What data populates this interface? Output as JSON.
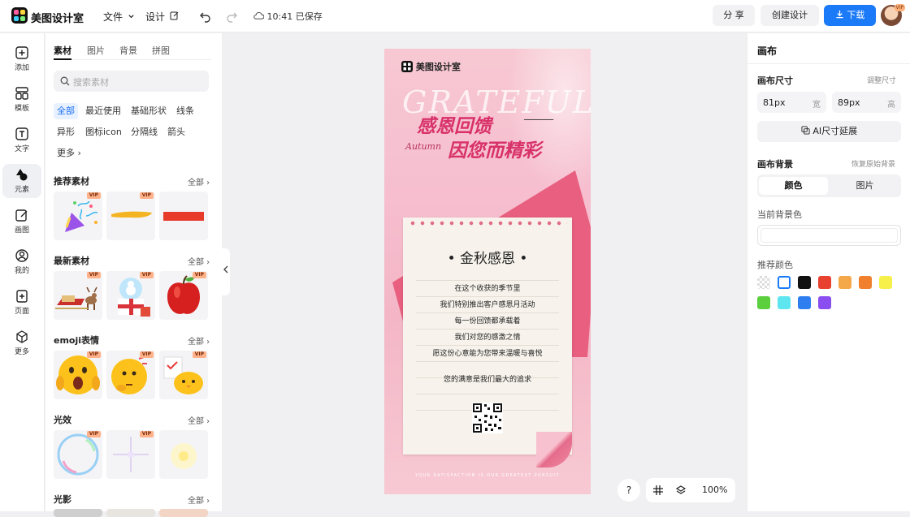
{
  "app": {
    "name": "美图设计室"
  },
  "topbar": {
    "file_menu": "文件",
    "design_menu": "设计",
    "save_status": "10:41 已保存",
    "share_label": "分 享",
    "create_label": "创建设计",
    "download_label": "下载",
    "avatar_badge": "VIP"
  },
  "rail": {
    "items": [
      {
        "label": "添加",
        "icon": "plus-square-icon"
      },
      {
        "label": "模板",
        "icon": "template-grid-icon"
      },
      {
        "label": "文字",
        "icon": "text-icon"
      },
      {
        "label": "元素",
        "icon": "shapes-icon"
      },
      {
        "label": "画图",
        "icon": "draw-icon"
      },
      {
        "label": "我的",
        "icon": "user-icon"
      },
      {
        "label": "页面",
        "icon": "page-add-icon"
      },
      {
        "label": "更多",
        "icon": "cube-icon"
      }
    ],
    "active": "元素"
  },
  "panel": {
    "tabs": [
      "素材",
      "图片",
      "背景",
      "拼图"
    ],
    "active_tab": "素材",
    "search_placeholder": "搜索素材",
    "chips": [
      "全部",
      "最近使用",
      "基础形状",
      "线条",
      "异形",
      "图标icon",
      "分隔线",
      "箭头",
      "更多"
    ],
    "active_chip": "全部",
    "all_label": "全部",
    "vip_label": "VIP",
    "sections": [
      {
        "title": "推荐素材"
      },
      {
        "title": "最新素材"
      },
      {
        "title": "emoji表情"
      },
      {
        "title": "光效"
      },
      {
        "title": "光影"
      }
    ]
  },
  "poster": {
    "brand": "美图设计室",
    "big_en": "GRATEFUL",
    "headline1": "感恩回馈",
    "headline2": "因您而精彩",
    "script_text": "Autumn",
    "card_title": "• 金秋感恩 •",
    "lines": [
      "在这个收获的季节里",
      "我们特别推出客户感恩月活动",
      "每一份回馈都承载着",
      "我们对您的感激之情",
      "愿这份心意能为您带来温暖与喜悦",
      "您的满意是我们最大的追求"
    ],
    "footer": "YOUR SATISFACTION IS OUR GREATEST PURSUIT"
  },
  "canvas_controls": {
    "help": "?",
    "zoom": "100%"
  },
  "right_panel": {
    "title": "画布",
    "size_label": "画布尺寸",
    "adjust_size": "调整尺寸",
    "width_value": "81px",
    "width_unit": "宽",
    "height_value": "89px",
    "height_unit": "高",
    "ai_extend": "AI尺寸延展",
    "bg_label": "画布背景",
    "restore_bg": "恢复原始背景",
    "seg_color": "颜色",
    "seg_image": "图片",
    "current_bg": "当前背景色",
    "recommend": "推荐颜色",
    "swatches": [
      "transparent",
      "#ffffff",
      "#111111",
      "#e8412f",
      "#f5a84a",
      "#f0802e",
      "#f7f04a",
      "#5ccf3f",
      "#5ee6f0",
      "#2f7ef0",
      "#8a4df0"
    ]
  }
}
